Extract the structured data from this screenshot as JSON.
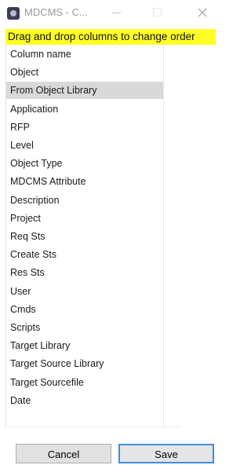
{
  "window": {
    "title": "MDCMS - C...",
    "close_glyph": "✕"
  },
  "hint": "Drag and drop columns to change order",
  "columns": [
    "Column name",
    "Object",
    "From Object Library",
    "Application",
    "RFP",
    "Level",
    "Object Type",
    "MDCMS Attribute",
    "Description",
    "Project",
    "Req Sts",
    "Create Sts",
    "Res Sts",
    "User",
    "Cmds",
    "Scripts",
    "Target Library",
    "Target Source Library",
    "Target Sourcefile",
    "Date"
  ],
  "selected_column": "From Object Library",
  "buttons": {
    "cancel": "Cancel",
    "save": "Save"
  },
  "colors": {
    "hint_background": "#ffff26",
    "selected_row": "#d9d9d9",
    "save_border": "#3b8ee0"
  }
}
